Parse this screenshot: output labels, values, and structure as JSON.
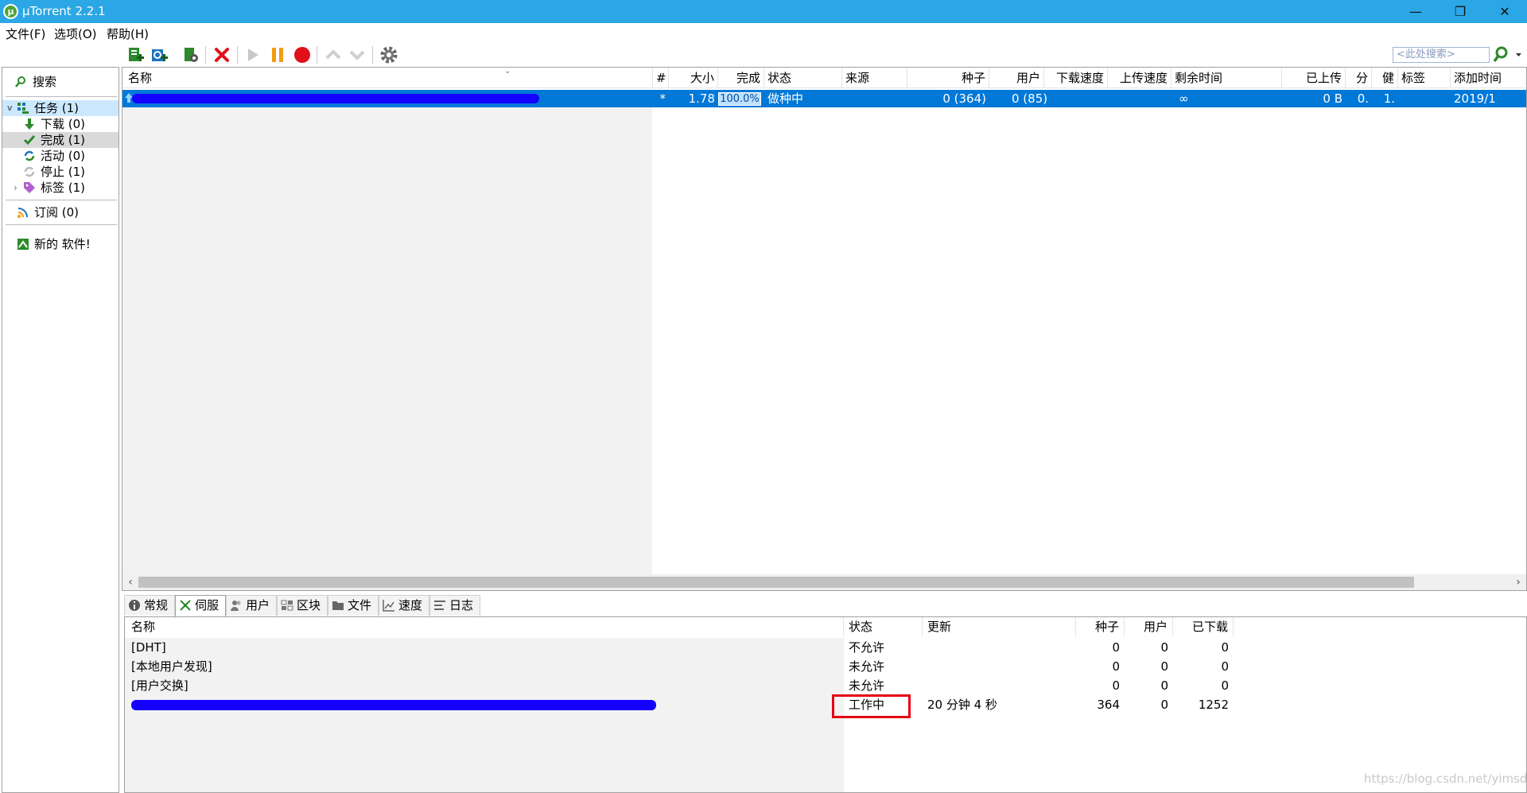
{
  "window": {
    "app_title": "µTorrent 2.2.1",
    "minimize": "—",
    "restore": "❐",
    "close": "✕"
  },
  "menu": [
    "文件(F)",
    "选项(O)",
    "帮助(H)"
  ],
  "toolbar": {
    "search_placeholder": "<此处搜索>"
  },
  "sidebar": {
    "search": "搜索",
    "tasks": "任务 (1)",
    "download": "下载 (0)",
    "completed": "完成 (1)",
    "active": "活动 (0)",
    "stopped": "停止 (1)",
    "labels": "标签 (1)",
    "feeds": "订阅 (0)",
    "new_software": "新的 软件!"
  },
  "torrent_list": {
    "columns": [
      "名称",
      "#",
      "大小",
      "完成",
      "状态",
      "来源",
      "种子",
      "用户",
      "下载速度",
      "上传速度",
      "剩余时间",
      "已上传",
      "分",
      "健",
      "标签",
      "添加时间"
    ],
    "rows": [
      {
        "star": "*",
        "size": "1.78",
        "done": "100.0%",
        "status": "做种中",
        "seeds": "0 (364)",
        "peers": "0 (85)",
        "eta": "∞",
        "uploaded": "0 B",
        "ratio": "0.",
        "health": "1.",
        "added": "2019/1"
      }
    ]
  },
  "tabs": [
    "常规",
    "伺服",
    "用户",
    "区块",
    "文件",
    "速度",
    "日志"
  ],
  "trackers": {
    "columns": [
      "名称",
      "状态",
      "更新",
      "种子",
      "用户",
      "已下载"
    ],
    "rows": [
      {
        "name": "[DHT]",
        "status": "不允许",
        "update": "",
        "seeds": "0",
        "peers": "0",
        "downloaded": "0"
      },
      {
        "name": "[本地用户发现]",
        "status": "未允许",
        "update": "",
        "seeds": "0",
        "peers": "0",
        "downloaded": "0"
      },
      {
        "name": "[用户交换]",
        "status": "未允许",
        "update": "",
        "seeds": "0",
        "peers": "0",
        "downloaded": "0"
      },
      {
        "name": "",
        "status": "工作中",
        "update": "20 分钟 4 秒",
        "seeds": "364",
        "peers": "0",
        "downloaded": "1252"
      }
    ]
  },
  "watermark": "https://blog.csdn.net/yimsdn",
  "colors": {
    "titlebar": "#2ba7e6",
    "selection": "#0078d7",
    "highlight_box": "#e60012",
    "redaction": "#1400ff"
  }
}
